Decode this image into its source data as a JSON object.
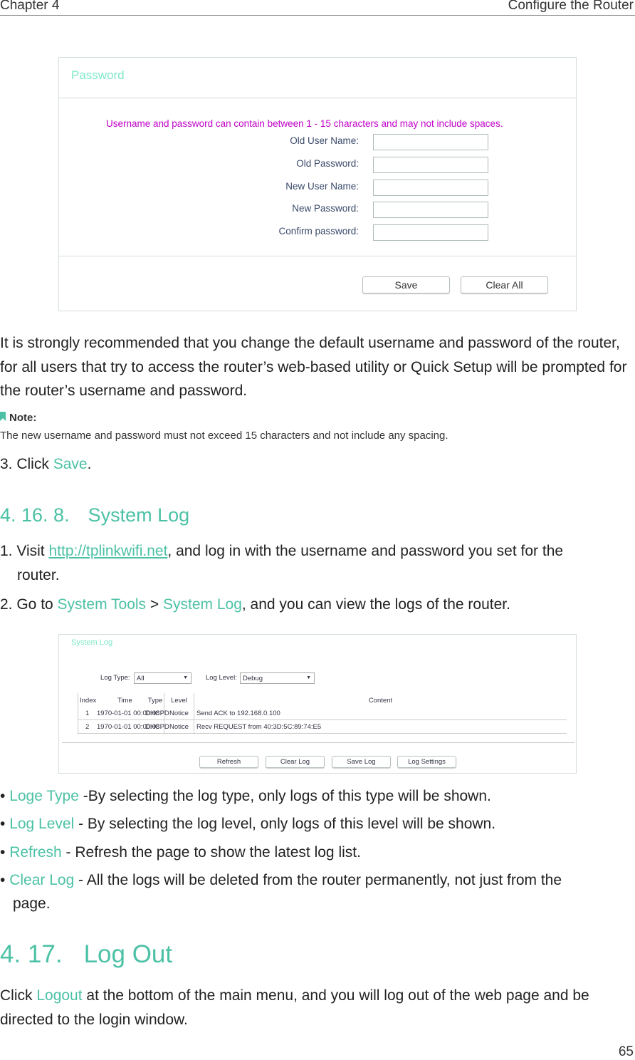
{
  "header": {
    "chapter": "Chapter 4",
    "section": "Configure the Router"
  },
  "password_panel": {
    "title": "Password",
    "hint": "Username and password can contain between 1 - 15 characters and may not include spaces.",
    "fields": [
      "Old User Name:",
      "Old Password:",
      "New User Name:",
      "New Password:",
      "Confirm password:"
    ],
    "save": "Save",
    "clear_all": "Clear All"
  },
  "para1": "It is strongly recommended that you change the default username and password of the router, for all users that try to access the router’s web-based utility or Quick Setup will be prompted for the router’s username and password.",
  "note": {
    "label": "Note:",
    "text": "The new username and password must not exceed 15 characters and not include any spacing."
  },
  "step3": {
    "prefix": "3. Click ",
    "link": "Save",
    "suffix": "."
  },
  "section1": {
    "number": "4. 16. 8.",
    "title": "System Log"
  },
  "steps": {
    "s1_prefix": "1. Visit ",
    "s1_link": "http://tplinkwifi.net",
    "s1_suffix": ", and log in with the username and password you set for the",
    "s1_cont": "router.",
    "s2_prefix": "2. Go to ",
    "s2_link1": "System Tools",
    "s2_sep": " > ",
    "s2_link2": "System Log",
    "s2_suffix": ", and you can view the logs of the router."
  },
  "log_panel": {
    "title": "System Log",
    "log_type_label": "Log Type:",
    "log_type_value": "All",
    "log_level_label": "Log Level:",
    "log_level_value": "Debug",
    "columns": [
      "Index",
      "Time",
      "Type",
      "Level",
      "Content"
    ],
    "rows": [
      [
        "1",
        "1970-01-01 00:00:08",
        "DHCPD",
        "Notice",
        "Send ACK to 192.168.0.100"
      ],
      [
        "2",
        "1970-01-01 00:00:08",
        "DHCPD",
        "Notice",
        "Recv REQUEST from 40:3D:5C:89:74:E5"
      ]
    ],
    "buttons": [
      "Refresh",
      "Clear Log",
      "Save Log",
      "Log Settings"
    ]
  },
  "bullets": [
    {
      "term": "Loge Type",
      "text": " -By selecting the log type, only logs of this type will be shown."
    },
    {
      "term": "Log Level",
      "text": " - By selecting the log level, only logs of this level will be shown."
    },
    {
      "term": "Refresh",
      "text": " - Refresh the page to show the latest log list."
    },
    {
      "term": "Clear Log",
      "text": " - All the logs will be deleted from the router permanently, not just from the",
      "cont": "page."
    }
  ],
  "section2": {
    "number": "4. 17.",
    "title": "Log Out"
  },
  "logout": {
    "prefix": "Click ",
    "link": "Logout",
    "suffix": " at the bottom of the main menu, and you will log out of the web page and be directed to the login window."
  },
  "page_number": "65"
}
